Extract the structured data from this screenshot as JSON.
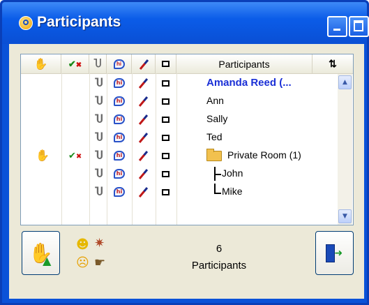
{
  "window": {
    "title": "Participants"
  },
  "grid": {
    "header": {
      "hand_icon": "raise-hand-icon",
      "approve_icon": "approve-deny-icon",
      "mic_icon": "microphone-icon",
      "chat_icon": "chat-icon",
      "pen_icon": "pen-icon",
      "window_icon": "window-icon",
      "participants_label": "Participants",
      "sort_label": "⇅"
    },
    "rows": [
      {
        "name": "Amanda Reed (...",
        "self": true,
        "hand": false,
        "approve": false
      },
      {
        "name": "Ann",
        "self": false,
        "hand": false,
        "approve": false
      },
      {
        "name": "Sally",
        "self": false,
        "hand": false,
        "approve": false
      },
      {
        "name": "Ted",
        "self": false,
        "hand": false,
        "approve": false
      },
      {
        "name": "Private Room (1)",
        "self": false,
        "hand": true,
        "approve": true,
        "folder": true
      },
      {
        "name": "John",
        "self": false,
        "hand": false,
        "approve": false,
        "tree": "branch"
      },
      {
        "name": "Mike",
        "self": false,
        "hand": false,
        "approve": false,
        "tree": "end"
      }
    ]
  },
  "footer": {
    "raise_hand_icon": "raise-hand-button-icon",
    "emoticons": [
      "smile-icon",
      "applause-icon",
      "confused-icon",
      "thumbs-icon"
    ],
    "count": "6",
    "count_label": "Participants",
    "leave_icon": "exit-door-icon"
  }
}
